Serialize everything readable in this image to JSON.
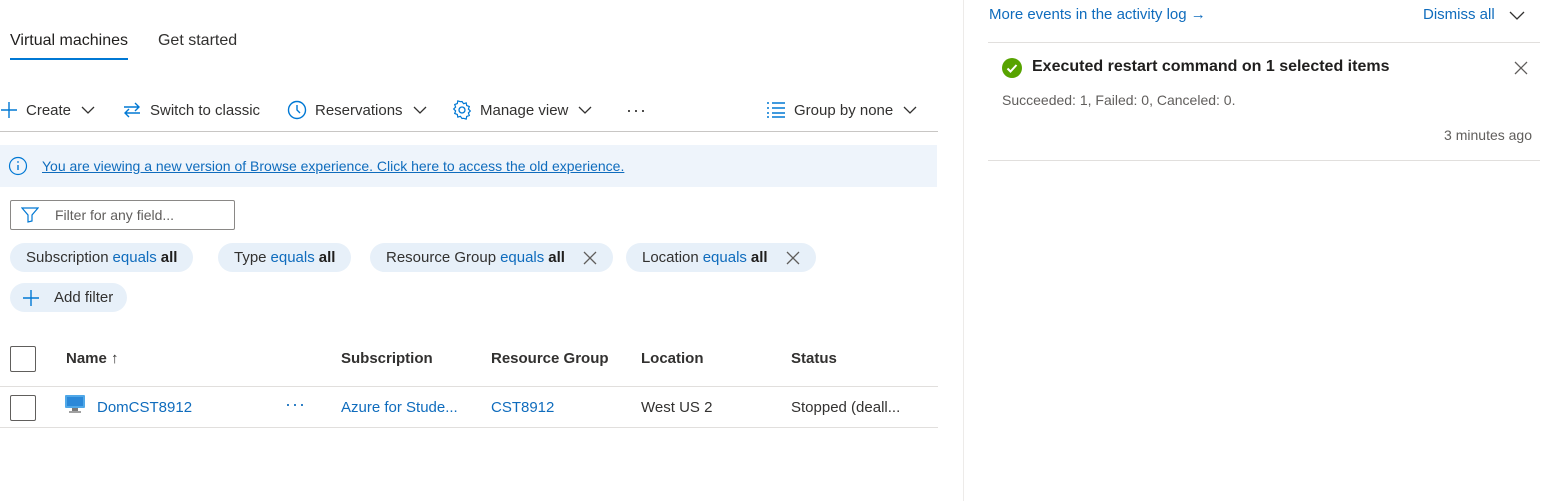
{
  "tabs": [
    {
      "label": "Virtual machines",
      "active": true
    },
    {
      "label": "Get started",
      "active": false
    }
  ],
  "toolbar": {
    "create": "Create",
    "switch_classic": "Switch to classic",
    "reservations": "Reservations",
    "manage_view": "Manage view",
    "more": "···",
    "group_by": "Group by none"
  },
  "banner": {
    "text": "You are viewing a new version of Browse experience. Click here to access the old experience."
  },
  "filter": {
    "placeholder": "Filter for any field..."
  },
  "pills": [
    {
      "field": "Subscription",
      "op": "equals",
      "value": "all",
      "removable": false
    },
    {
      "field": "Type",
      "op": "equals",
      "value": "all",
      "removable": false
    },
    {
      "field": "Resource Group",
      "op": "equals",
      "value": "all",
      "removable": true
    },
    {
      "field": "Location",
      "op": "equals",
      "value": "all",
      "removable": true
    }
  ],
  "add_filter": "Add filter",
  "table": {
    "headers": {
      "name": "Name ↑",
      "subscription": "Subscription",
      "resource_group": "Resource Group",
      "location": "Location",
      "status": "Status"
    },
    "rows": [
      {
        "name": "DomCST8912",
        "actions": "···",
        "subscription": "Azure for Stude...",
        "resource_group": "CST8912",
        "location": "West US 2",
        "status": "Stopped (deall..."
      }
    ]
  },
  "notifications": {
    "activity_log_link": "More events in the activity log →",
    "dismiss_all": "Dismiss all",
    "items": [
      {
        "title": "Executed restart command on 1 selected items",
        "body": "Succeeded: 1, Failed: 0, Canceled: 0.",
        "time": "3 minutes ago",
        "status": "success"
      }
    ]
  },
  "colors": {
    "accent": "#0078d4",
    "link": "#0f6cbd",
    "success": "#57a300",
    "pill_bg": "#e7f0f9",
    "banner_bg": "#eef4fb"
  }
}
